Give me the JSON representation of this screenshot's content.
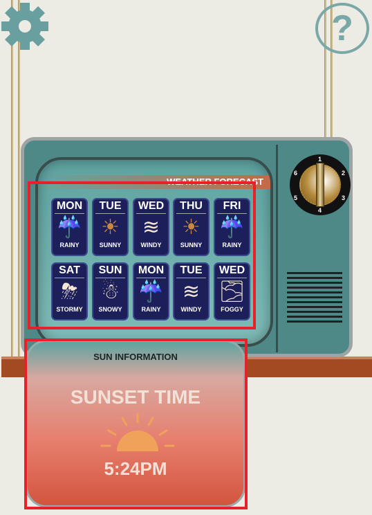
{
  "toolbar": {
    "settings_icon": "gear-icon",
    "help_label": "?"
  },
  "tv": {
    "banner": "WEATHER FORECAST",
    "dial_numbers": [
      "1",
      "2",
      "3",
      "4",
      "5",
      "6"
    ],
    "dial_selected": "4"
  },
  "forecast": [
    {
      "day": "MON",
      "condition": "RAINY",
      "icon": "rain-cloud"
    },
    {
      "day": "TUE",
      "condition": "SUNNY",
      "icon": "sun"
    },
    {
      "day": "WED",
      "condition": "WINDY",
      "icon": "wind"
    },
    {
      "day": "THU",
      "condition": "SUNNY",
      "icon": "sun"
    },
    {
      "day": "FRI",
      "condition": "RAINY",
      "icon": "rain-cloud"
    },
    {
      "day": "SAT",
      "condition": "STORMY",
      "icon": "storm-cloud"
    },
    {
      "day": "SUN",
      "condition": "SNOWY",
      "icon": "snowman"
    },
    {
      "day": "MON",
      "condition": "RAINY",
      "icon": "rain-cloud"
    },
    {
      "day": "TUE",
      "condition": "WINDY",
      "icon": "wind"
    },
    {
      "day": "WED",
      "condition": "FOGGY",
      "icon": "fog"
    }
  ],
  "sun_info": {
    "header": "SUN INFORMATION",
    "title": "SUNSET TIME",
    "time": "5:24PM"
  },
  "colors": {
    "highlight": "#e8202a",
    "card": "#1c1f5a",
    "tv": "#4e8988"
  }
}
